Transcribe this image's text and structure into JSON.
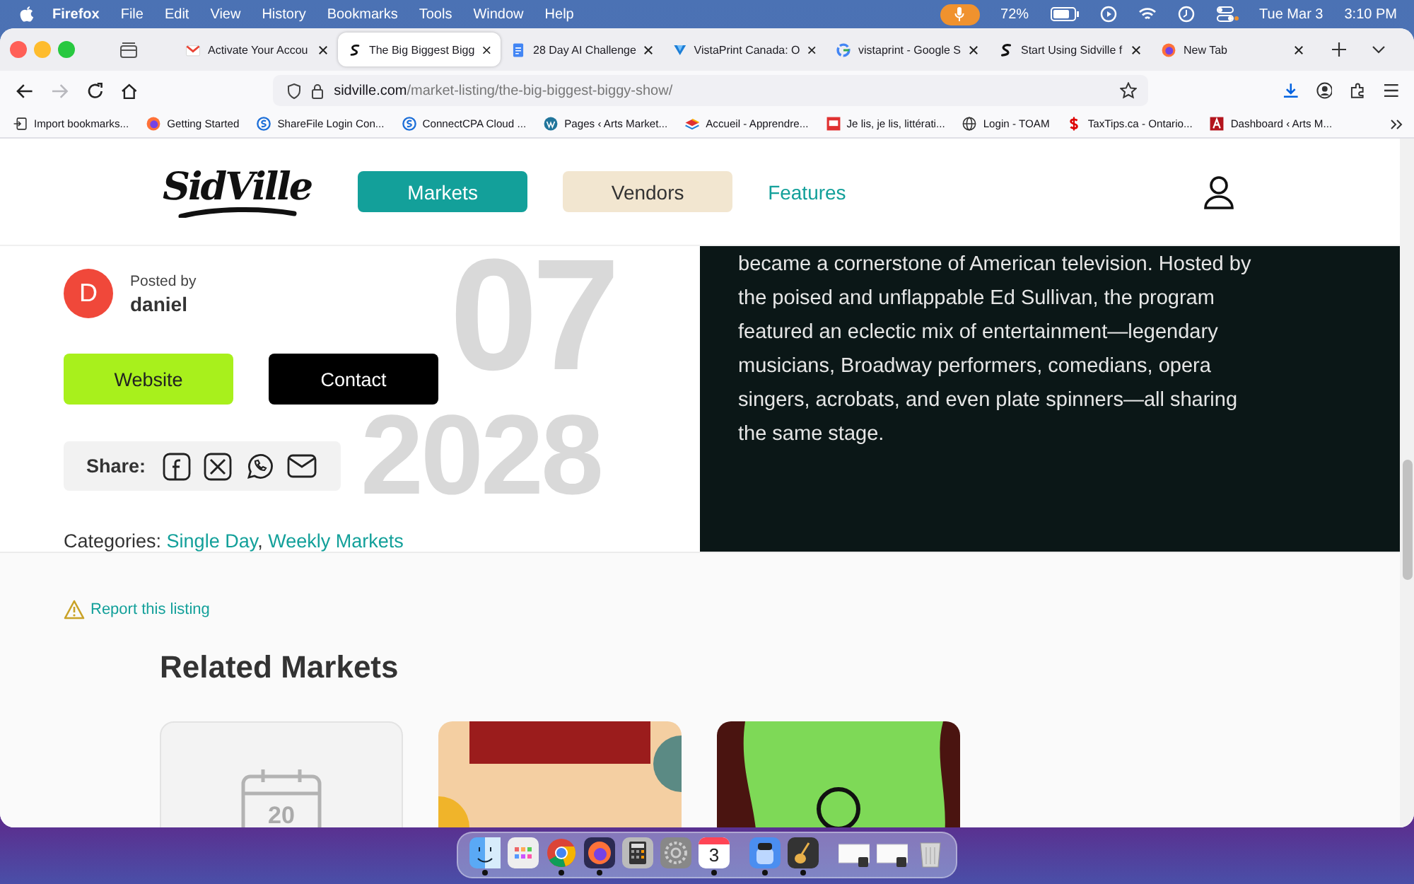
{
  "menubar": {
    "app": "Firefox",
    "menus": [
      "File",
      "Edit",
      "View",
      "History",
      "Bookmarks",
      "Tools",
      "Window",
      "Help"
    ],
    "battery": "72%",
    "date": "Tue Mar 3",
    "time": "3:10 PM"
  },
  "tabs": [
    {
      "title": "Activate Your Accou",
      "kind": "mail",
      "selected": false
    },
    {
      "title": "The Big Biggest Bigg",
      "kind": "sidville",
      "selected": true
    },
    {
      "title": "28 Day AI Challenge",
      "kind": "doc",
      "selected": false
    },
    {
      "title": "VistaPrint Canada: O",
      "kind": "vista",
      "selected": false
    },
    {
      "title": "vistaprint - Google S",
      "kind": "google",
      "selected": false
    },
    {
      "title": "Start Using Sidville f",
      "kind": "sidville",
      "selected": false
    },
    {
      "title": "New Tab",
      "kind": "firefox",
      "selected": false
    }
  ],
  "nav_buttons": [
    {
      "kind": "back",
      "disabled": false
    },
    {
      "kind": "forward",
      "disabled": true
    },
    {
      "kind": "reload",
      "disabled": false
    },
    {
      "kind": "home",
      "disabled": false
    }
  ],
  "address": {
    "domain": "sidville.com",
    "path": "/market-listing/the-big-biggest-biggy-show/"
  },
  "bookmarks": [
    {
      "title": "Import bookmarks...",
      "kind": "import"
    },
    {
      "title": "Getting Started",
      "kind": "firefox"
    },
    {
      "title": "ShareFile Login Con...",
      "kind": "sharefile"
    },
    {
      "title": "ConnectCPA Cloud ...",
      "kind": "sharefile"
    },
    {
      "title": "Pages ‹ Arts Market...",
      "kind": "wordpress"
    },
    {
      "title": "Accueil - Apprendre...",
      "kind": "stack"
    },
    {
      "title": "Je lis, je lis, littérati...",
      "kind": "redsquare"
    },
    {
      "title": "Login - TOAM",
      "kind": "globe"
    },
    {
      "title": "TaxTips.ca - Ontario...",
      "kind": "dollar"
    },
    {
      "title": "Dashboard ‹ Arts M...",
      "kind": "darkred"
    }
  ],
  "site": {
    "logo": "SidVille",
    "nav": [
      {
        "label": "Markets",
        "kind": "primary"
      },
      {
        "label": "Vendors",
        "kind": "secondary"
      },
      {
        "label": "Features",
        "kind": "link"
      }
    ],
    "author": {
      "initial": "D",
      "label": "Posted by",
      "name": "daniel"
    },
    "buttons": [
      {
        "label": "Website",
        "kind": "accent"
      },
      {
        "label": "Contact",
        "kind": "dark"
      }
    ],
    "share": {
      "label": "Share:"
    },
    "categories": {
      "label": "Categories:",
      "separator": ",",
      "links": [
        "Single Day",
        "Weekly Markets"
      ]
    },
    "date_watermark": {
      "month": "07",
      "year": "2028"
    },
    "description": "became a cornerstone of American television. Hosted by the poised and unflappable Ed Sullivan, the program featured an eclectic mix of entertainment—legendary musicians, Broadway performers, comedians, opera singers, acrobats, and even plate spinners—all sharing the same stage.",
    "report": "Report this listing",
    "related": {
      "title": "Related Markets",
      "cards": [
        {
          "kind": "placeholder",
          "day": "20"
        },
        {
          "kind": "poster"
        },
        {
          "kind": "photo"
        }
      ]
    }
  },
  "dock": {
    "apps": [
      {
        "kind": "finder",
        "running": true
      },
      {
        "kind": "launchpad",
        "running": false
      },
      {
        "kind": "chrome",
        "running": true
      },
      {
        "kind": "firefox",
        "running": true
      },
      {
        "kind": "calculator",
        "running": false
      },
      {
        "kind": "settings",
        "running": false
      },
      {
        "kind": "calendar",
        "label": "3",
        "running": true
      },
      {
        "kind": "separator"
      },
      {
        "kind": "preview",
        "running": true
      },
      {
        "kind": "garageband",
        "running": true
      },
      {
        "kind": "separator"
      },
      {
        "kind": "window",
        "running": false
      },
      {
        "kind": "window",
        "running": false
      },
      {
        "kind": "trash",
        "running": false
      }
    ]
  }
}
